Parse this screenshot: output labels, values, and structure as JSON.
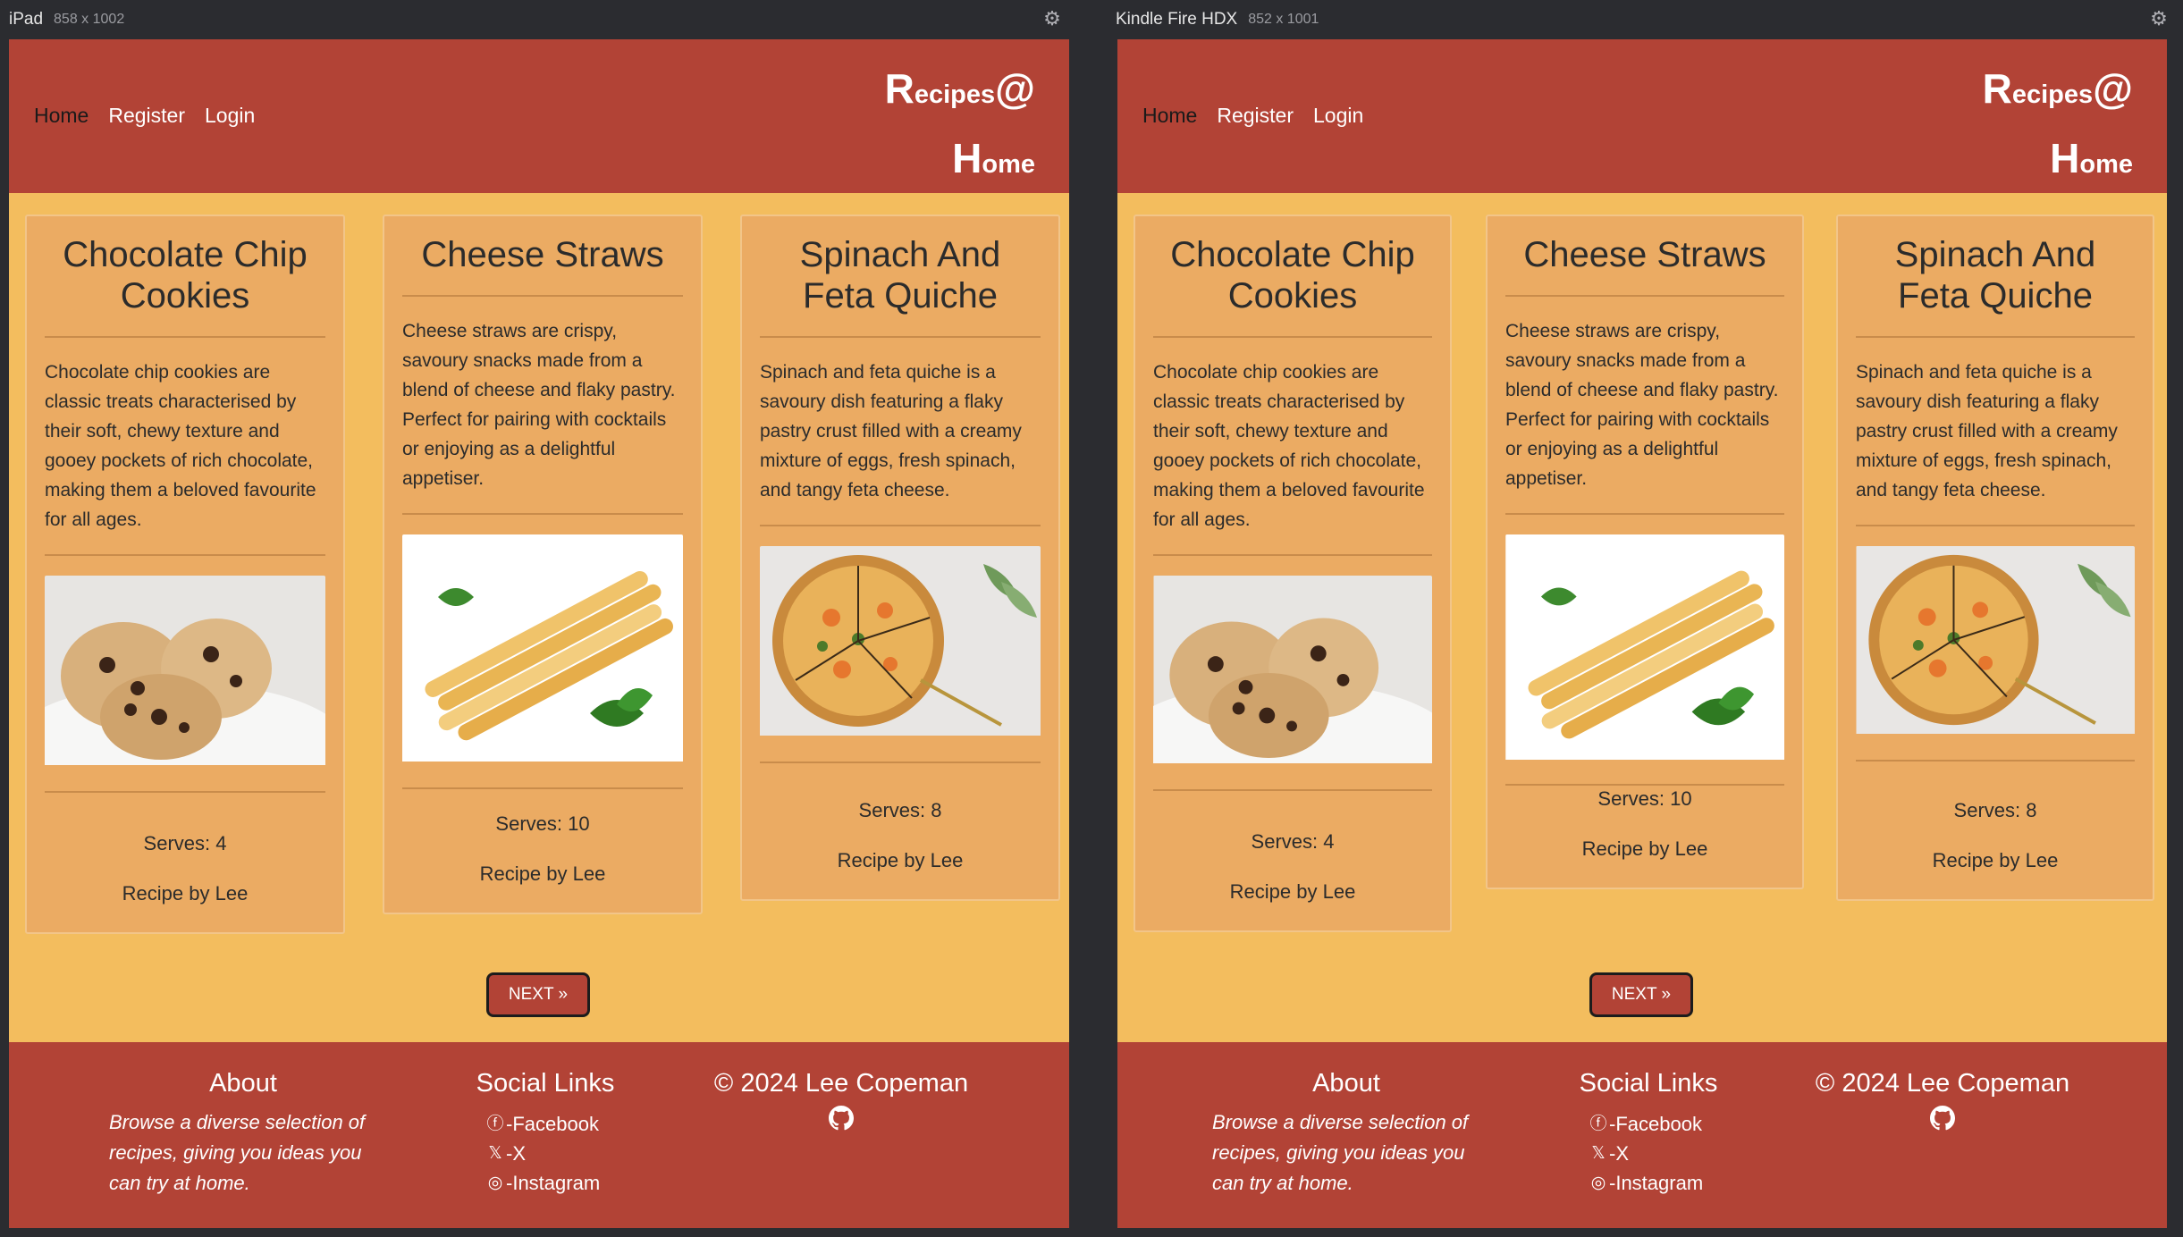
{
  "devices": [
    {
      "name": "iPad",
      "dims": "858 x 1002",
      "serves": [
        "Serves: 4",
        "Serves: 10",
        "Serves: 8"
      ]
    },
    {
      "name": "Kindle Fire HDX",
      "dims": "852 x 1001",
      "serves": [
        "Serves: 4",
        "Serves: 10",
        "Serves: 8"
      ]
    }
  ],
  "nav": {
    "home": "Home",
    "register": "Register",
    "login": "Login"
  },
  "brand": {
    "line1_big": "R",
    "line1_small": "ecipes",
    "line1_at": "@",
    "line2_big": "H",
    "line2_small": "ome"
  },
  "cards": [
    {
      "title": "Chocolate Chip Cookies",
      "description": "Chocolate chip cookies are classic treats characterised by their soft, chewy texture and gooey pockets of rich chocolate, making them a beloved favourite for all ages.",
      "image": "chocolate-chip-cookies-photo",
      "serves": "Serves: 4",
      "byline": "Recipe by Lee"
    },
    {
      "title": "Cheese Straws",
      "description": "Cheese straws are crispy, savoury snacks made from a blend of cheese and flaky pastry. Perfect for pairing with cocktails or enjoying as a delightful appetiser.",
      "image": "cheese-straws-photo",
      "serves": "Serves: 10",
      "byline": "Recipe by Lee"
    },
    {
      "title": "Spinach And Feta Quiche",
      "description": "Spinach and feta quiche is a savoury dish featuring a flaky pastry crust filled with a creamy mixture of eggs, fresh spinach, and tangy feta cheese.",
      "image": "spinach-feta-quiche-photo",
      "serves": "Serves: 8",
      "byline": "Recipe by Lee"
    }
  ],
  "pagination": {
    "next": "NEXT »"
  },
  "footer": {
    "about_title": "About",
    "about_text": "Browse a diverse selection of recipes, giving you ideas you can try at home.",
    "social_title": "Social Links",
    "facebook": "-Facebook",
    "x": "-X",
    "instagram": "-Instagram",
    "copyright": "© 2024 Lee Copeman"
  },
  "colors": {
    "header": "#b24336",
    "page": "#f3bd5e",
    "card": "#ebab63",
    "chrome": "#2b2c30"
  },
  "icons": [
    "gear-icon",
    "facebook-icon",
    "x-icon",
    "instagram-icon",
    "github-icon"
  ]
}
